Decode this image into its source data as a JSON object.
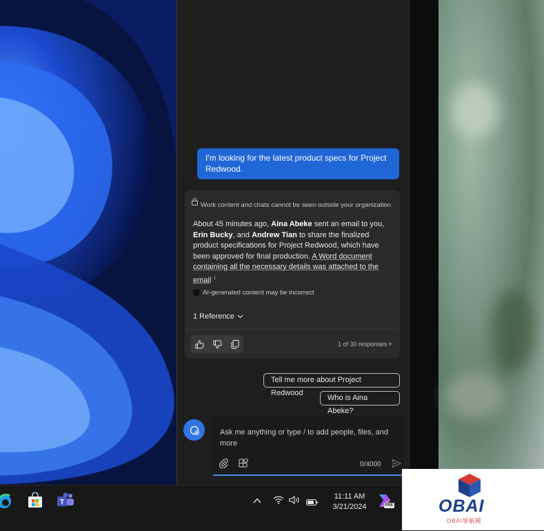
{
  "chat": {
    "user_message": "I'm looking for the latest product specs for Project Redwood.",
    "privacy_note": "Work content and chats cannot be seen outside your organization",
    "response": {
      "part1": "About 45 minutes ago, ",
      "name1": "Aina Abeke",
      "part2": " sent an email to you, ",
      "name2": "Erin Bucky",
      "part3": ", and ",
      "name3": "Andrew Tian",
      "part4": " to share the finalized product specifications for Project Redwood, which have been approved for final production. ",
      "link_text": "A Word document containing all the necessary details was attached to the email",
      "citation": "1"
    },
    "disclaimer": "AI-generated content may be incorrect",
    "references_label": "1 Reference",
    "response_count": "1 of 30 responses",
    "suggestions": [
      "Tell me more about Project Redwood",
      "Who is Aina Abeke?"
    ],
    "input_placeholder": "Ask me anything or type / to add people, files, and more",
    "char_count": "0/4000"
  },
  "taskbar": {
    "time": "11:11 AM",
    "date": "3/21/2024",
    "copilot_badge": "PRE"
  },
  "watermark": {
    "title": "OBAI",
    "subtitle": "OBAI导航网"
  },
  "colors": {
    "accent": "#1f66d6",
    "panel_bg": "#1e1e1e",
    "card_bg": "#2a2a2a"
  }
}
